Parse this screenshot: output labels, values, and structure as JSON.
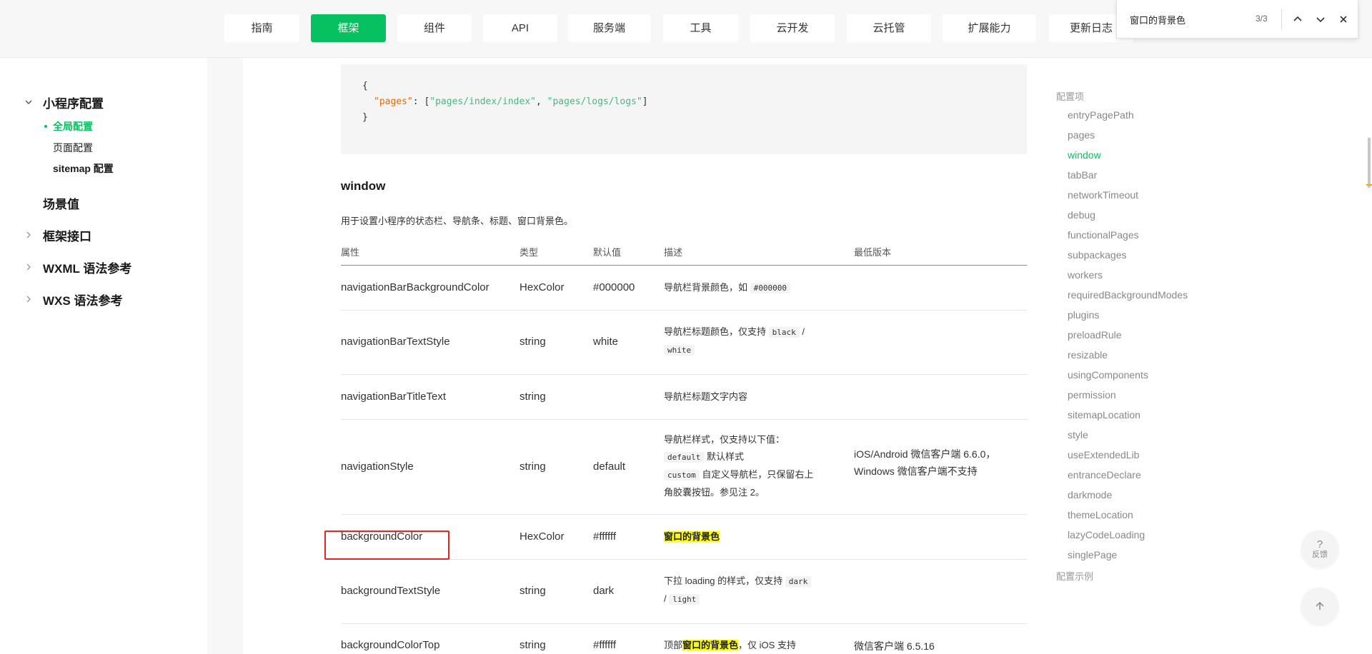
{
  "nav": {
    "tabs": [
      "指南",
      "框架",
      "组件",
      "API",
      "服务端",
      "工具",
      "云开发",
      "云托管",
      "扩展能力",
      "更新日志"
    ],
    "active": "框架"
  },
  "findbar": {
    "query": "窗口的背景色",
    "count": "3/3"
  },
  "sidebar": {
    "group1": "小程序配置",
    "group1_items": [
      "全局配置",
      "页面配置",
      "sitemap 配置"
    ],
    "group2": "场景值",
    "group3": "框架接口",
    "group4": "WXML 语法参考",
    "group5": "WXS 语法参考"
  },
  "code": {
    "open": "{",
    "key": "\"pages\"",
    "colon": ": [",
    "v1": "\"pages/index/index\"",
    "comma": ", ",
    "v2": "\"pages/logs/logs\"",
    "close_arr": "]",
    "close": "}"
  },
  "section": {
    "title": "window",
    "desc": "用于设置小程序的状态栏、导航条、标题、窗口背景色。"
  },
  "table": {
    "headers": [
      "属性",
      "类型",
      "默认值",
      "描述",
      "最低版本"
    ],
    "rows": [
      {
        "prop": "navigationBarBackgroundColor",
        "type": "HexColor",
        "default": "#000000",
        "desc_text": "导航栏背景颜色，如",
        "desc_code": "#000000",
        "version": ""
      },
      {
        "prop": "navigationBarTextStyle",
        "type": "string",
        "default": "white",
        "desc_text": "导航栏标题颜色，仅支持",
        "desc_code1": "black",
        "desc_sep": "/",
        "desc_code2": "white",
        "version": ""
      },
      {
        "prop": "navigationBarTitleText",
        "type": "string",
        "default": "",
        "desc_text": "导航栏标题文字内容",
        "version": ""
      },
      {
        "prop": "navigationStyle",
        "type": "string",
        "default": "default",
        "desc_line1": "导航栏样式，仅支持以下值：",
        "desc_code1": "default",
        "desc_line2": "默认样式",
        "desc_code2": "custom",
        "desc_line3": "自定义导航栏，只保留右上",
        "desc_line4": "角胶囊按钮。参见注 2。",
        "version_line1": "iOS/Android 微信客户端 6.6.0，",
        "version_line2": "Windows 微信客户端不支持"
      },
      {
        "prop": "backgroundColor",
        "type": "HexColor",
        "default": "#ffffff",
        "desc_text": "窗口的背景色",
        "version": ""
      },
      {
        "prop": "backgroundTextStyle",
        "type": "string",
        "default": "dark",
        "desc_text": "下拉 loading 的样式，仅支持",
        "desc_code1": "dark",
        "desc_sep": "/",
        "desc_code2": "light",
        "version": ""
      },
      {
        "prop": "backgroundColorTop",
        "type": "string",
        "default": "#ffffff",
        "desc_pre": "顶部",
        "desc_hl": "窗口的背景色",
        "desc_post": "，仅 iOS 支持",
        "version": "微信客户端 6.5.16"
      }
    ]
  },
  "toc": {
    "head": "配置项",
    "items": [
      "entryPagePath",
      "pages",
      "window",
      "tabBar",
      "networkTimeout",
      "debug",
      "functionalPages",
      "subpackages",
      "workers",
      "requiredBackgroundModes",
      "plugins",
      "preloadRule",
      "resizable",
      "usingComponents",
      "permission",
      "sitemapLocation",
      "style",
      "useExtendedLib",
      "entranceDeclare",
      "darkmode",
      "themeLocation",
      "lazyCodeLoading",
      "singlePage"
    ],
    "active": "window",
    "foot": "配置示例"
  },
  "float": {
    "feedback_q": "?",
    "feedback_label": "反馈"
  },
  "colors": {
    "accent": "#07c160",
    "highlight": "#fdff00",
    "selection_box": "#e32424"
  }
}
